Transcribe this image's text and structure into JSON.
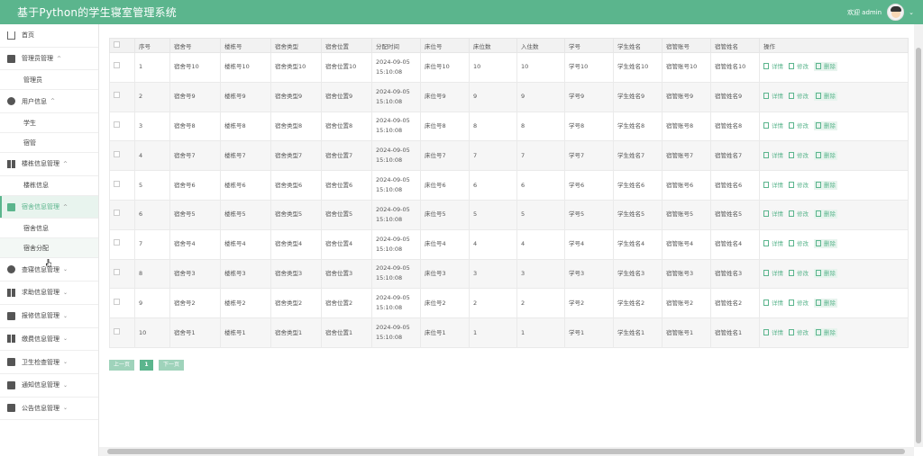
{
  "header": {
    "title": "基于Python的学生寝室管理系统",
    "welcome": "欢迎 admin"
  },
  "sidebar": {
    "home": "首页",
    "groups": [
      {
        "label": "管理员管理",
        "icon": "admin-icon",
        "expanded": true,
        "children": [
          "管理员"
        ]
      },
      {
        "label": "用户信息",
        "icon": "user-icon",
        "expanded": true,
        "children": [
          "学生",
          "宿管"
        ]
      },
      {
        "label": "楼栋信息管理",
        "icon": "building-icon",
        "expanded": true,
        "children": [
          "楼栋信息"
        ]
      },
      {
        "label": "宿舍信息管理",
        "icon": "dorm-icon",
        "expanded": true,
        "active": true,
        "children": [
          "宿舍信息",
          "宿舍分配"
        ]
      },
      {
        "label": "查寝信息管理",
        "icon": "check-icon",
        "children": []
      },
      {
        "label": "求助信息管理",
        "icon": "help-icon",
        "children": []
      },
      {
        "label": "报修信息管理",
        "icon": "repair-icon",
        "children": []
      },
      {
        "label": "缴费信息管理",
        "icon": "fee-icon",
        "children": []
      },
      {
        "label": "卫生检查管理",
        "icon": "hygiene-icon",
        "children": []
      },
      {
        "label": "通知信息管理",
        "icon": "notice-icon",
        "children": []
      },
      {
        "label": "公告信息管理",
        "icon": "announce-icon",
        "children": []
      }
    ]
  },
  "table": {
    "headers": [
      "序号",
      "宿舍号",
      "楼栋号",
      "宿舍类型",
      "宿舍位置",
      "分配时间",
      "床位号",
      "床位数",
      "入住数",
      "学号",
      "学生姓名",
      "宿管账号",
      "宿管姓名",
      "操作"
    ],
    "rows": [
      [
        "1",
        "宿舍号10",
        "楼栋号10",
        "宿舍类型10",
        "宿舍位置10",
        "2024-09-05",
        "15:10:08",
        "床位号10",
        "10",
        "10",
        "学号10",
        "学生姓名10",
        "宿管账号10",
        "宿管姓名10"
      ],
      [
        "2",
        "宿舍号9",
        "楼栋号9",
        "宿舍类型9",
        "宿舍位置9",
        "2024-09-05",
        "15:10:08",
        "床位号9",
        "9",
        "9",
        "学号9",
        "学生姓名9",
        "宿管账号9",
        "宿管姓名9"
      ],
      [
        "3",
        "宿舍号8",
        "楼栋号8",
        "宿舍类型8",
        "宿舍位置8",
        "2024-09-05",
        "15:10:08",
        "床位号8",
        "8",
        "8",
        "学号8",
        "学生姓名8",
        "宿管账号8",
        "宿管姓名8"
      ],
      [
        "4",
        "宿舍号7",
        "楼栋号7",
        "宿舍类型7",
        "宿舍位置7",
        "2024-09-05",
        "15:10:08",
        "床位号7",
        "7",
        "7",
        "学号7",
        "学生姓名7",
        "宿管账号7",
        "宿管姓名7"
      ],
      [
        "5",
        "宿舍号6",
        "楼栋号6",
        "宿舍类型6",
        "宿舍位置6",
        "2024-09-05",
        "15:10:08",
        "床位号6",
        "6",
        "6",
        "学号6",
        "学生姓名6",
        "宿管账号6",
        "宿管姓名6"
      ],
      [
        "6",
        "宿舍号5",
        "楼栋号5",
        "宿舍类型5",
        "宿舍位置5",
        "2024-09-05",
        "15:10:08",
        "床位号5",
        "5",
        "5",
        "学号5",
        "学生姓名5",
        "宿管账号5",
        "宿管姓名5"
      ],
      [
        "7",
        "宿舍号4",
        "楼栋号4",
        "宿舍类型4",
        "宿舍位置4",
        "2024-09-05",
        "15:10:08",
        "床位号4",
        "4",
        "4",
        "学号4",
        "学生姓名4",
        "宿管账号4",
        "宿管姓名4"
      ],
      [
        "8",
        "宿舍号3",
        "楼栋号3",
        "宿舍类型3",
        "宿舍位置3",
        "2024-09-05",
        "15:10:08",
        "床位号3",
        "3",
        "3",
        "学号3",
        "学生姓名3",
        "宿管账号3",
        "宿管姓名3"
      ],
      [
        "9",
        "宿舍号2",
        "楼栋号2",
        "宿舍类型2",
        "宿舍位置2",
        "2024-09-05",
        "15:10:08",
        "床位号2",
        "2",
        "2",
        "学号2",
        "学生姓名2",
        "宿管账号2",
        "宿管姓名2"
      ],
      [
        "10",
        "宿舍号1",
        "楼栋号1",
        "宿舍类型1",
        "宿舍位置1",
        "2024-09-05",
        "15:10:08",
        "床位号1",
        "1",
        "1",
        "学号1",
        "学生姓名1",
        "宿管账号1",
        "宿管姓名1"
      ]
    ],
    "actions": [
      "详情",
      "修改",
      "删除"
    ]
  },
  "pager": {
    "prev": "上一页",
    "current": "1",
    "next": "下一页"
  },
  "colors": {
    "primary": "#5bb58d"
  }
}
